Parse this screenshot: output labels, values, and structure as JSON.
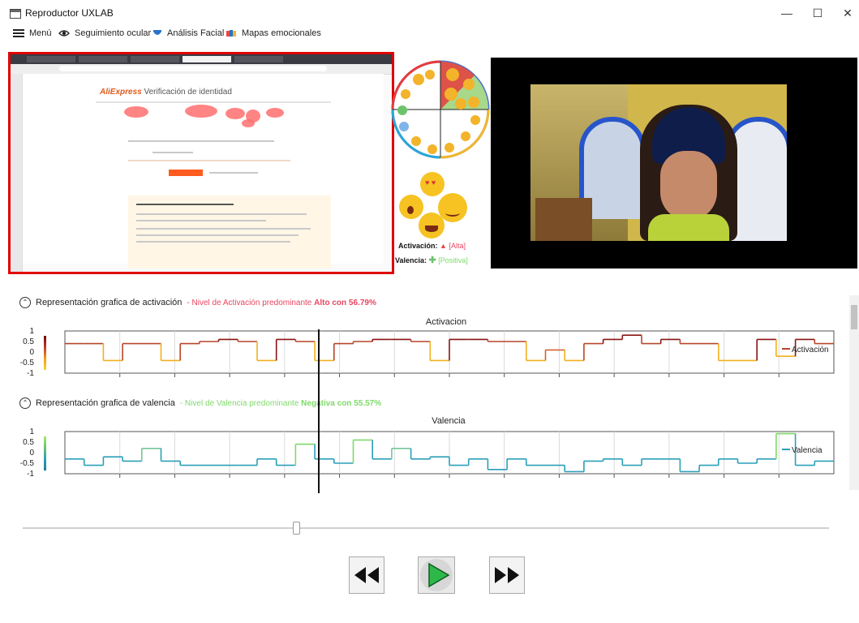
{
  "window": {
    "title": "Reproductor UXLAB",
    "minimize": "—",
    "maximize": "☐",
    "close": "✕"
  },
  "menu": [
    {
      "label": "Menú",
      "icon": "hamburger-icon"
    },
    {
      "label": "Seguimiento ocular",
      "icon": "eye-icon"
    },
    {
      "label": "Análisis Facial",
      "icon": "face-icon"
    },
    {
      "label": "Mapas emocionales",
      "icon": "map-icon"
    }
  ],
  "screen": {
    "brand": "AliExpress",
    "heading": "Verificación de identidad"
  },
  "emotion": {
    "activation_label": "Activación:",
    "activation_value": "[Alta]",
    "valence_label": "Valencia:",
    "valence_value": "[Positiva]"
  },
  "sections": {
    "activation": {
      "heading": "Representación grafica de activación",
      "detail_prefix": "- Nivel de Activación predominante",
      "detail_value": "Alto con 56.79%"
    },
    "valence": {
      "heading": "Representación grafica de valencia",
      "detail_prefix": "- Nivel de Valencia predominante",
      "detail_value": "Negativa con 55.57%"
    }
  },
  "colors": {
    "activation_text": "#e84560",
    "valence_text": "#7fd96b",
    "accent_border": "#e00000"
  },
  "chart_data": [
    {
      "type": "line",
      "title": "Activacion",
      "legend": "Activación",
      "ylim": [
        -1,
        1
      ],
      "yticks": [
        "1",
        "0.5",
        "0",
        "-0.5",
        "-1"
      ],
      "x": [
        0,
        1,
        2,
        3,
        4,
        5,
        6,
        7,
        8,
        9,
        10,
        11,
        12,
        13,
        14,
        15,
        16,
        17,
        18,
        19,
        20,
        21,
        22,
        23,
        24,
        25,
        26,
        27,
        28,
        29,
        30,
        31,
        32,
        33,
        34,
        35,
        36,
        37,
        38,
        39
      ],
      "values": [
        0.4,
        0.4,
        -0.4,
        0.4,
        0.4,
        -0.4,
        0.4,
        0.5,
        0.6,
        0.5,
        -0.4,
        0.6,
        0.5,
        -0.4,
        0.4,
        0.5,
        0.6,
        0.6,
        0.5,
        -0.4,
        0.6,
        0.6,
        0.5,
        0.5,
        -0.4,
        0.1,
        -0.4,
        0.4,
        0.6,
        0.8,
        0.4,
        0.6,
        0.4,
        0.4,
        -0.4,
        -0.4,
        0.6,
        -0.2,
        0.6,
        0.4
      ],
      "grid": true
    },
    {
      "type": "line",
      "title": "Valencia",
      "legend": "Valencia",
      "ylim": [
        -1,
        1
      ],
      "yticks": [
        "1",
        "0.5",
        "0",
        "-0.5",
        "-1"
      ],
      "x": [
        0,
        1,
        2,
        3,
        4,
        5,
        6,
        7,
        8,
        9,
        10,
        11,
        12,
        13,
        14,
        15,
        16,
        17,
        18,
        19,
        20,
        21,
        22,
        23,
        24,
        25,
        26,
        27,
        28,
        29,
        30,
        31,
        32,
        33,
        34,
        35,
        36,
        37,
        38,
        39
      ],
      "values": [
        -0.3,
        -0.6,
        -0.2,
        -0.4,
        0.2,
        -0.4,
        -0.6,
        -0.6,
        -0.6,
        -0.6,
        -0.3,
        -0.6,
        0.4,
        -0.3,
        -0.5,
        0.6,
        -0.3,
        0.2,
        -0.3,
        -0.2,
        -0.6,
        -0.3,
        -0.8,
        -0.3,
        -0.6,
        -0.6,
        -0.9,
        -0.4,
        -0.3,
        -0.6,
        -0.3,
        -0.3,
        -0.9,
        -0.6,
        -0.3,
        -0.5,
        -0.3,
        0.9,
        -0.6,
        -0.4
      ],
      "grid": true
    }
  ],
  "controls": [
    {
      "label": "Retroceder",
      "icon": "rewind-icon"
    },
    {
      "label": "Reproducir",
      "icon": "play-icon"
    },
    {
      "label": "Avanzar",
      "icon": "fast-forward-icon"
    }
  ]
}
